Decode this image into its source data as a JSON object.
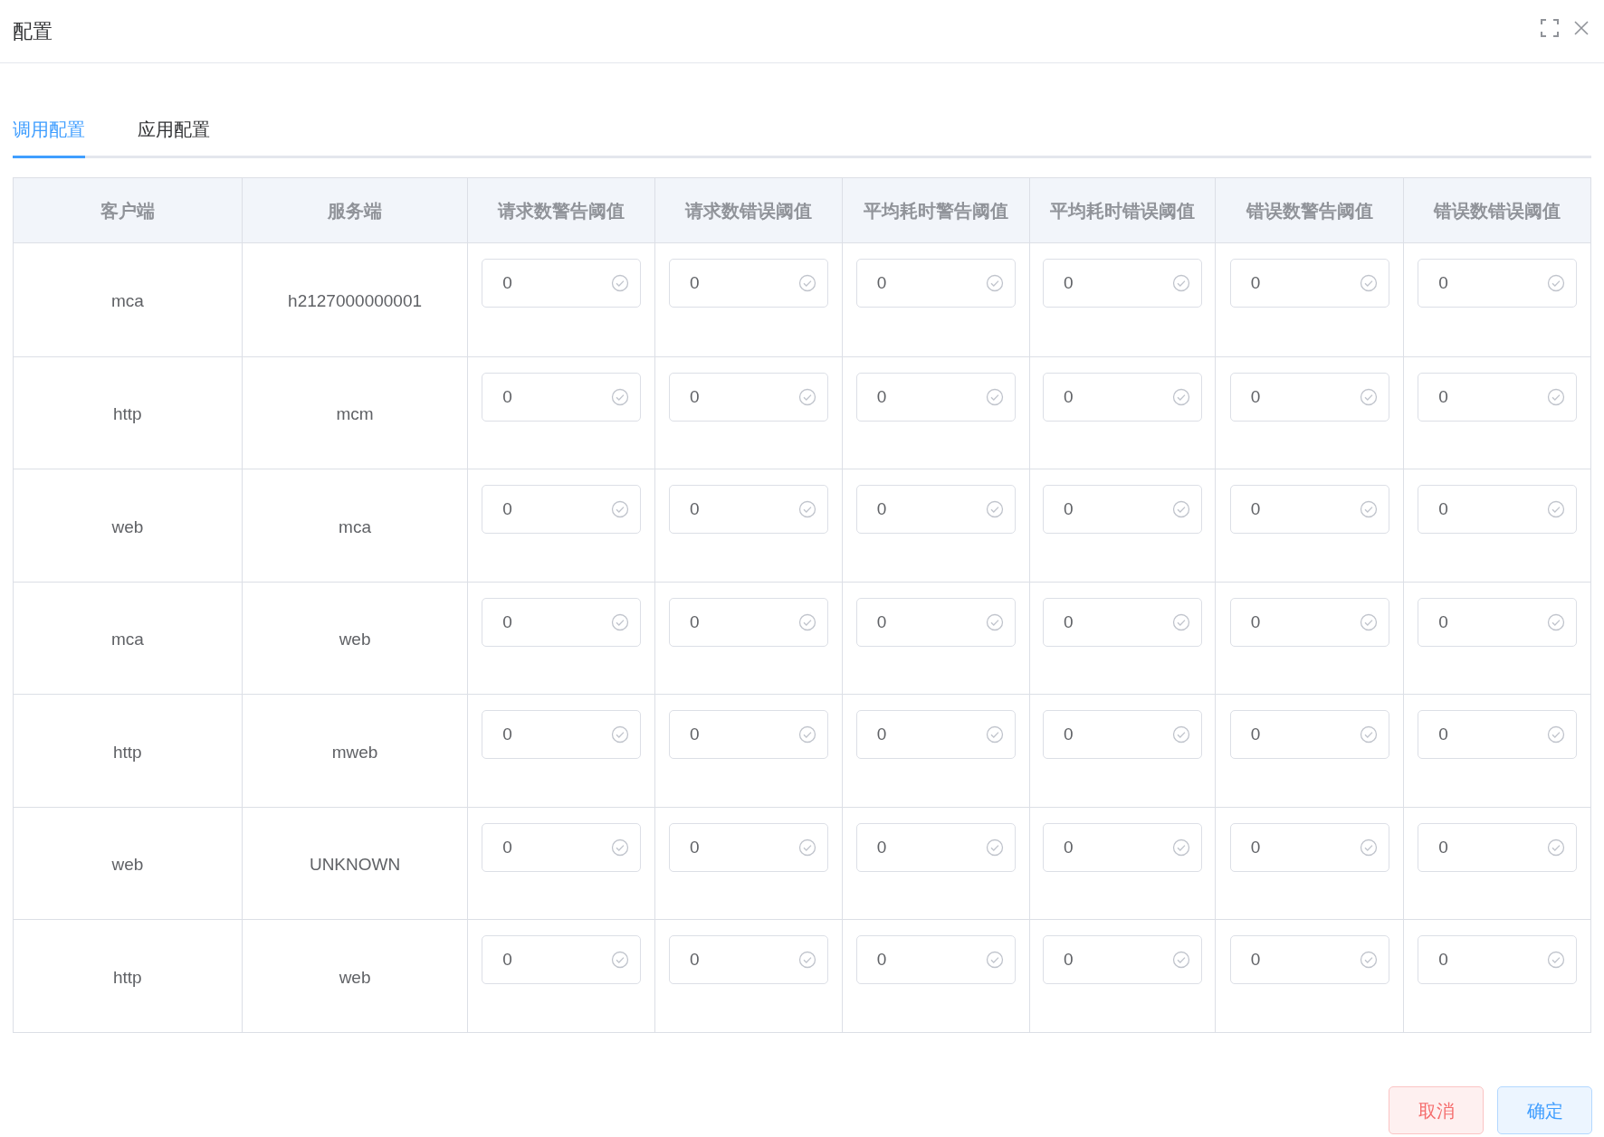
{
  "dialog": {
    "title": "配置"
  },
  "tabs": [
    {
      "label": "调用配置",
      "selected": true
    },
    {
      "label": "应用配置",
      "selected": false
    }
  ],
  "table": {
    "columns": [
      "客户端",
      "服务端",
      "请求数警告阈值",
      "请求数错误阈值",
      "平均耗时警告阈值",
      "平均耗时错误阈值",
      "错误数警告阈值",
      "错误数错误阈值"
    ],
    "rows": [
      {
        "client": "mca",
        "server": "h2127000000001",
        "values": [
          "0",
          "0",
          "0",
          "0",
          "0",
          "0"
        ]
      },
      {
        "client": "http",
        "server": "mcm",
        "values": [
          "0",
          "0",
          "0",
          "0",
          "0",
          "0"
        ]
      },
      {
        "client": "web",
        "server": "mca",
        "values": [
          "0",
          "0",
          "0",
          "0",
          "0",
          "0"
        ]
      },
      {
        "client": "mca",
        "server": "web",
        "values": [
          "0",
          "0",
          "0",
          "0",
          "0",
          "0"
        ]
      },
      {
        "client": "http",
        "server": "mweb",
        "values": [
          "0",
          "0",
          "0",
          "0",
          "0",
          "0"
        ]
      },
      {
        "client": "web",
        "server": "UNKNOWN",
        "values": [
          "0",
          "0",
          "0",
          "0",
          "0",
          "0"
        ]
      },
      {
        "client": "http",
        "server": "web",
        "values": [
          "0",
          "0",
          "0",
          "0",
          "0",
          "0"
        ]
      }
    ]
  },
  "buttons": [
    {
      "label": "取消",
      "kind": "danger"
    },
    {
      "label": "确定",
      "kind": "primary"
    }
  ]
}
